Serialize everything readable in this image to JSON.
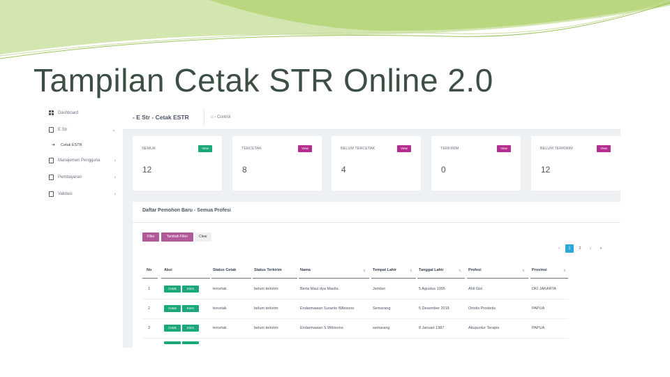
{
  "slide": {
    "title": "Tampilan Cetak STR Online 2.0"
  },
  "colors": {
    "accent_green": "#1ba77a",
    "view_magenta": "#b52e8f",
    "filter_purple": "#b05a9a",
    "pager_blue": "#2aa9d8",
    "title_color": "#3d4f44"
  },
  "sidebar": {
    "items": [
      {
        "label": "Dashboard",
        "icon": "grid-icon"
      },
      {
        "label": "E Str",
        "icon": "document-icon",
        "chevron": "⌄"
      },
      {
        "label": "Manajemen Pengguna",
        "icon": "document-icon",
        "chevron": "›"
      },
      {
        "label": "Pembayaran",
        "icon": "document-icon",
        "chevron": "›"
      },
      {
        "label": "Validasi",
        "icon": "document-icon",
        "chevron": "›"
      }
    ],
    "subitem": {
      "label": "Cetak ESTR",
      "icon": "arrow-right-icon"
    }
  },
  "topbar": {
    "title": "- E Str - Cetak ESTR",
    "breadcrumb": "- Control"
  },
  "cards": [
    {
      "label": "SEMUA",
      "value": "12",
      "button": "View"
    },
    {
      "label": "TERCETAK",
      "value": "8",
      "button": "View"
    },
    {
      "label": "BELUM TERCETAK",
      "value": "4",
      "button": "View"
    },
    {
      "label": "TERKIRIM",
      "value": "0",
      "button": "View"
    },
    {
      "label": "BELUM TERKIRIM",
      "value": "12",
      "button": "View"
    }
  ],
  "panel": {
    "title": "Daftar Pemohon Baru - Semua Profesi",
    "buttons": {
      "filter": "Filter",
      "tambah": "Tambah Filter",
      "clear": "Clear"
    },
    "pager": [
      "‹",
      "1",
      "2",
      "›",
      "»"
    ]
  },
  "table": {
    "headers": [
      "No",
      "Aksi",
      "Status Cetak",
      "Status Terkirim",
      "Nama",
      "Tempat Lahir",
      "Tanggal Lahir",
      "Profesi",
      "Provinsi"
    ],
    "action_labels": {
      "cetak": "Cetak",
      "kirim": "Kirim"
    },
    "rows": [
      [
        "1",
        "tercetak",
        "belum terkirim",
        "Berta Maul dya Masita",
        "Jember",
        "5 Agustus 1995",
        "Ahli Gizi",
        "DKI JAKARTA"
      ],
      [
        "2",
        "tercetak",
        "belum terkirim",
        "Endarmawan Suranto Wibisono",
        "Semarang",
        "5 Desember 2018",
        "Ortotis Prostetis",
        "PAPUA"
      ],
      [
        "3",
        "tercetak",
        "belum terkirim",
        "Endarmawan S Wibisono",
        "semarang",
        "8 Januari 1987",
        "Akupuntur Terapis",
        "PAPUA"
      ]
    ]
  }
}
